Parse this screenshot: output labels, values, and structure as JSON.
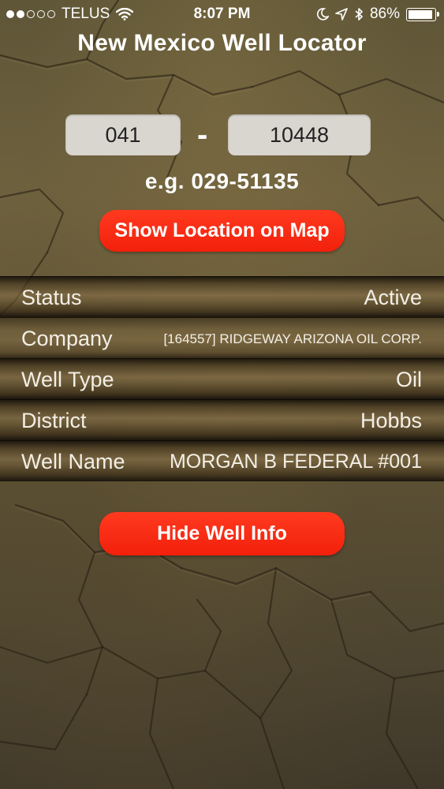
{
  "status_bar": {
    "carrier": "TELUS",
    "time": "8:07 PM",
    "battery": "86%",
    "battery_level": 0.86,
    "signal_bars": 2,
    "signal_total": 5
  },
  "title": "New Mexico Well Locator",
  "form": {
    "prefix_value": "041",
    "number_value": "10448",
    "separator": "-",
    "example": "e.g. 029-51135",
    "show_map_button": "Show Location on Map"
  },
  "well_info": {
    "rows": [
      {
        "label": "Status",
        "value": "Active"
      },
      {
        "label": "Company",
        "value": "[164557] RIDGEWAY ARIZONA OIL CORP."
      },
      {
        "label": "Well Type",
        "value": "Oil"
      },
      {
        "label": "District",
        "value": "Hobbs"
      },
      {
        "label": "Well Name",
        "value": "MORGAN B FEDERAL #001"
      }
    ]
  },
  "hide_button": "Hide Well Info",
  "colors": {
    "button": "#f2200b",
    "field_bg": "#d9d6cf",
    "background": "#5e5234"
  }
}
